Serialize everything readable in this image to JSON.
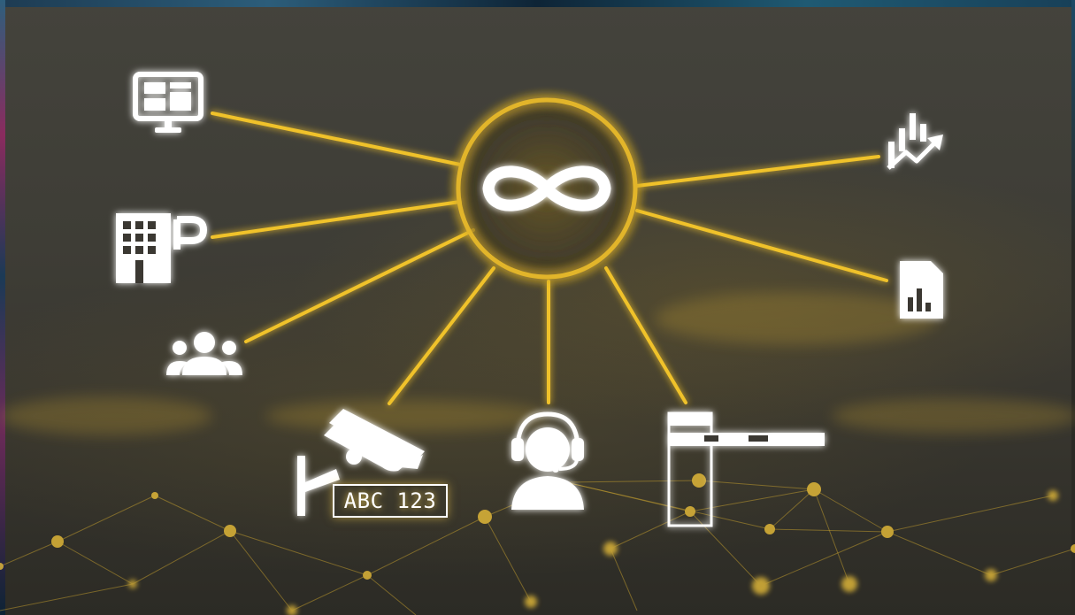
{
  "scene": {
    "license_plate_text": "ABC 123",
    "colors": {
      "accent": "#f0c22a",
      "icon": "#ffffff",
      "background": "#3f3e37"
    },
    "icons": [
      "infinity-icon",
      "monitor-dashboard-icon",
      "parking-building-icon",
      "people-group-icon",
      "security-camera-icon",
      "customer-support-headset-icon",
      "parking-barrier-gate-icon",
      "analytics-chart-icon",
      "report-document-icon"
    ]
  }
}
